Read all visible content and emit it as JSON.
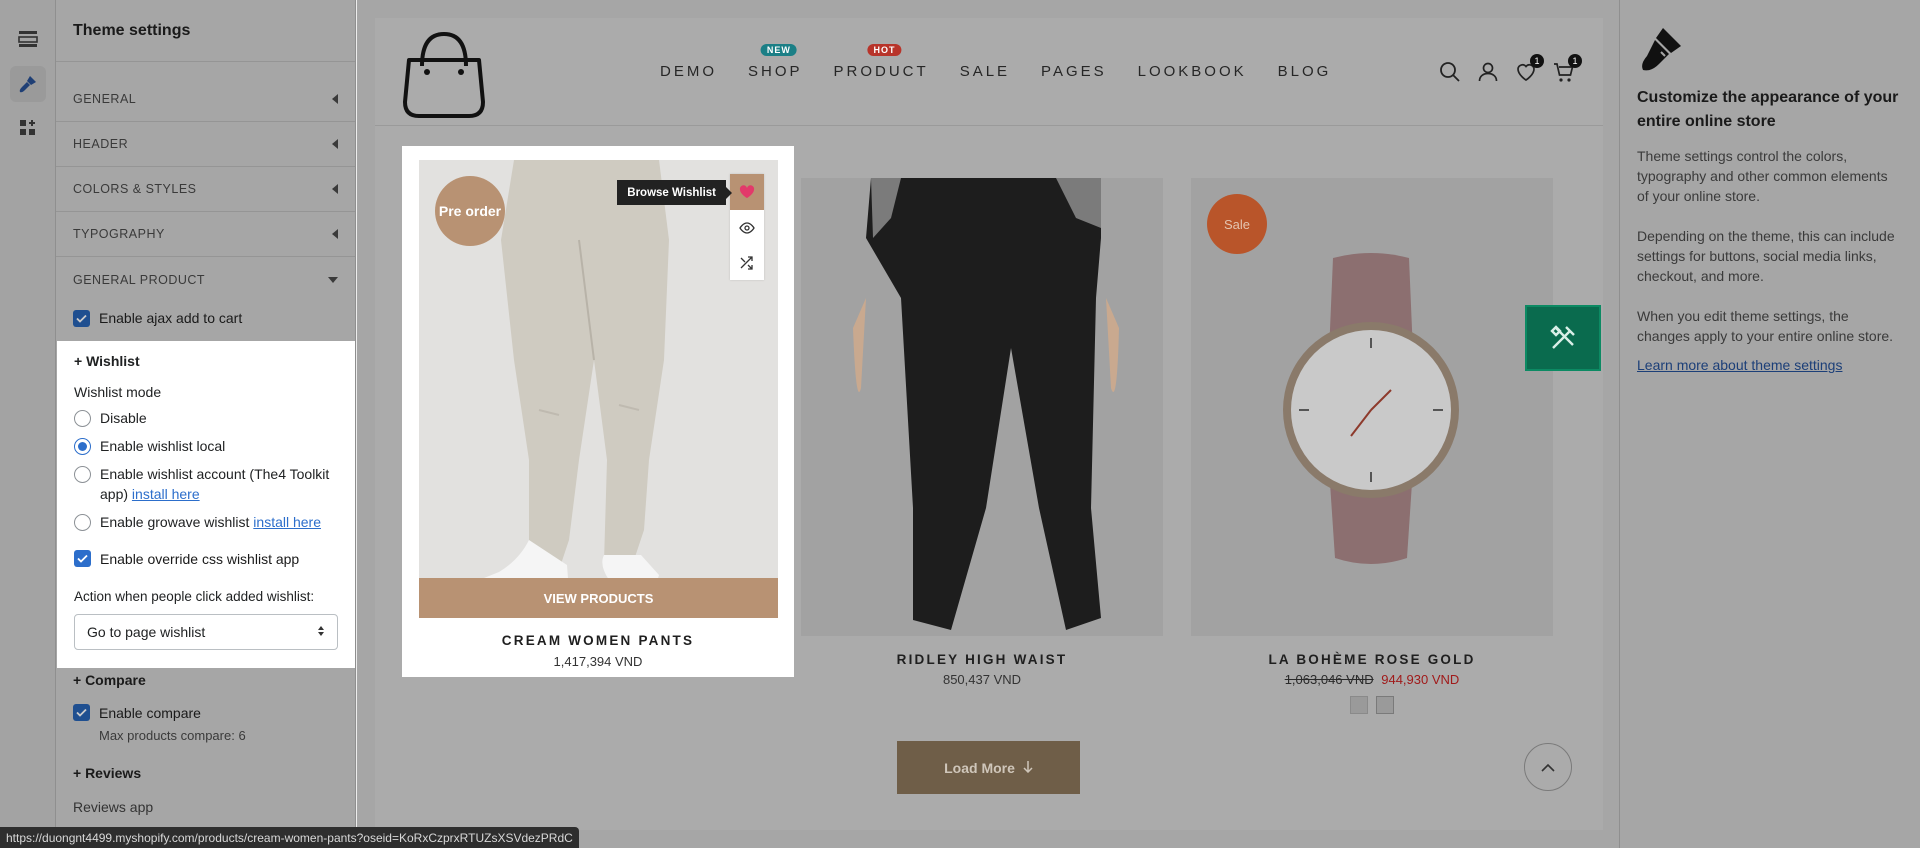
{
  "panel": {
    "title": "Theme settings",
    "sections": [
      {
        "label": "GENERAL"
      },
      {
        "label": "HEADER"
      },
      {
        "label": "COLORS & STYLES"
      },
      {
        "label": "TYPOGRAPHY"
      },
      {
        "label": "GENERAL PRODUCT"
      }
    ],
    "ajax_label": "Enable ajax add to cart",
    "wishlist": {
      "title": "+ Wishlist",
      "mode_label": "Wishlist mode",
      "options": [
        {
          "label": "Disable",
          "selected": false
        },
        {
          "label": "Enable wishlist local",
          "selected": true
        },
        {
          "label": "Enable wishlist account (The4 Toolkit app)",
          "link": "install here",
          "selected": false
        },
        {
          "label": "Enable growave wishlist",
          "link": "install here",
          "selected": false
        }
      ],
      "override_label": "Enable override css wishlist app",
      "action_label": "Action when people click added wishlist:",
      "action_value": "Go to page wishlist"
    },
    "compare": {
      "title": "+ Compare",
      "enable_label": "Enable compare",
      "max_label": "Max products compare: 6"
    },
    "reviews": {
      "title": "+ Reviews",
      "app_label": "Reviews app"
    }
  },
  "store": {
    "nav": [
      {
        "label": "DEMO",
        "badge": "",
        "badge_color": ""
      },
      {
        "label": "SHOP",
        "badge": "NEW",
        "badge_color": "#1b7f86"
      },
      {
        "label": "PRODUCT",
        "badge": "HOT",
        "badge_color": "#b8342a"
      },
      {
        "label": "SALE",
        "badge": "",
        "badge_color": ""
      },
      {
        "label": "PAGES",
        "badge": "",
        "badge_color": ""
      },
      {
        "label": "LOOKBOOK",
        "badge": "",
        "badge_color": ""
      },
      {
        "label": "BLOG",
        "badge": "",
        "badge_color": ""
      }
    ],
    "wishlist_count": "1",
    "cart_count": "1",
    "products": [
      {
        "name": "CREAM WOMEN PANTS",
        "price": "1,417,394 VND",
        "badge": "Pre order",
        "badge_color": "#b89273",
        "tooltip": "Browse Wishlist",
        "cta": "VIEW PRODUCTS"
      },
      {
        "name": "RIDLEY HIGH WAIST",
        "price": "850,437 VND"
      },
      {
        "name": "LA BOHÈME ROSE GOLD",
        "old_price": "1,063,046 VND",
        "sale_price": "944,930 VND",
        "badge": "Sale",
        "badge_color": "#b9552a"
      }
    ],
    "load_more": "Load More"
  },
  "info": {
    "heading": "Customize the appearance of your entire online store",
    "p1": "Theme settings control the colors, typography and other common elements of your online store.",
    "p2": "Depending on the theme, this can include settings for buttons, social media links, checkout, and more.",
    "p3": "When you edit theme settings, the changes apply to your entire online store.",
    "link": "Learn more about theme settings"
  },
  "status_url": "https://duongnt4499.myshopify.com/products/cream-women-pants?oseid=KoRxCzprxRTUZsXSVdezPRdC"
}
